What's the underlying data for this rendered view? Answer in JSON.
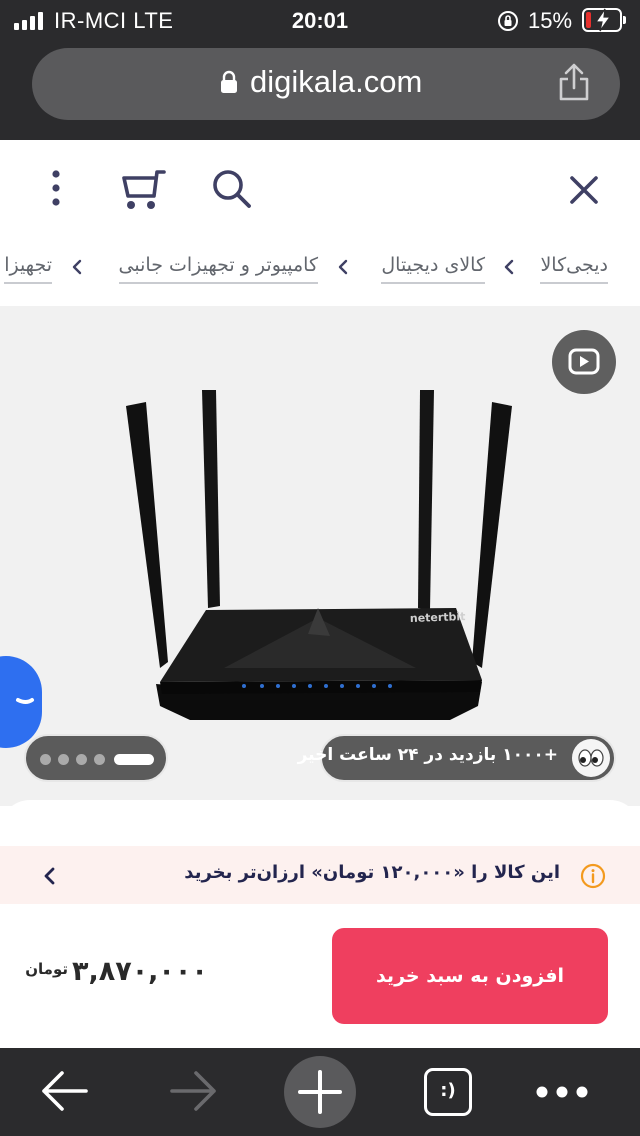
{
  "status_bar": {
    "carrier": "IR-MCI   LTE",
    "time": "20:01",
    "battery": "15%",
    "battery_level": 0.15
  },
  "address_bar": {
    "domain": "digikala.com"
  },
  "header": {
    "icons": [
      "more-vertical-icon",
      "cart-icon",
      "search-icon",
      "close-icon"
    ]
  },
  "breadcrumb": {
    "items": [
      "دیجی‌کالا",
      "کالای دیجیتال",
      "کامپیوتر و تجهیزات جانبی",
      "تجهیزا"
    ]
  },
  "gallery": {
    "router_brand": "netertbit",
    "views_badge": "+۱۰۰۰ بازدید در ۲۴ ساعت اخیر",
    "slides_total": 5,
    "slide_active": 1
  },
  "cheaper_banner": {
    "text": "این کالا را «۱۲۰,۰۰۰ تومان» ارزان‌تر بخرید"
  },
  "buy_bar": {
    "add_to_cart": "افزودن به سبد خرید",
    "price": "۳,۸۷۰,۰۰۰",
    "currency": "تومان"
  },
  "toolbar": {
    "tabs_label": ":)"
  },
  "colors": {
    "chrome": "#2b2b2d",
    "accent": "#ef3f5f",
    "banner_bg": "#fdf1ef",
    "info": "#f39a1e",
    "float_button": "#2e6ff0"
  }
}
